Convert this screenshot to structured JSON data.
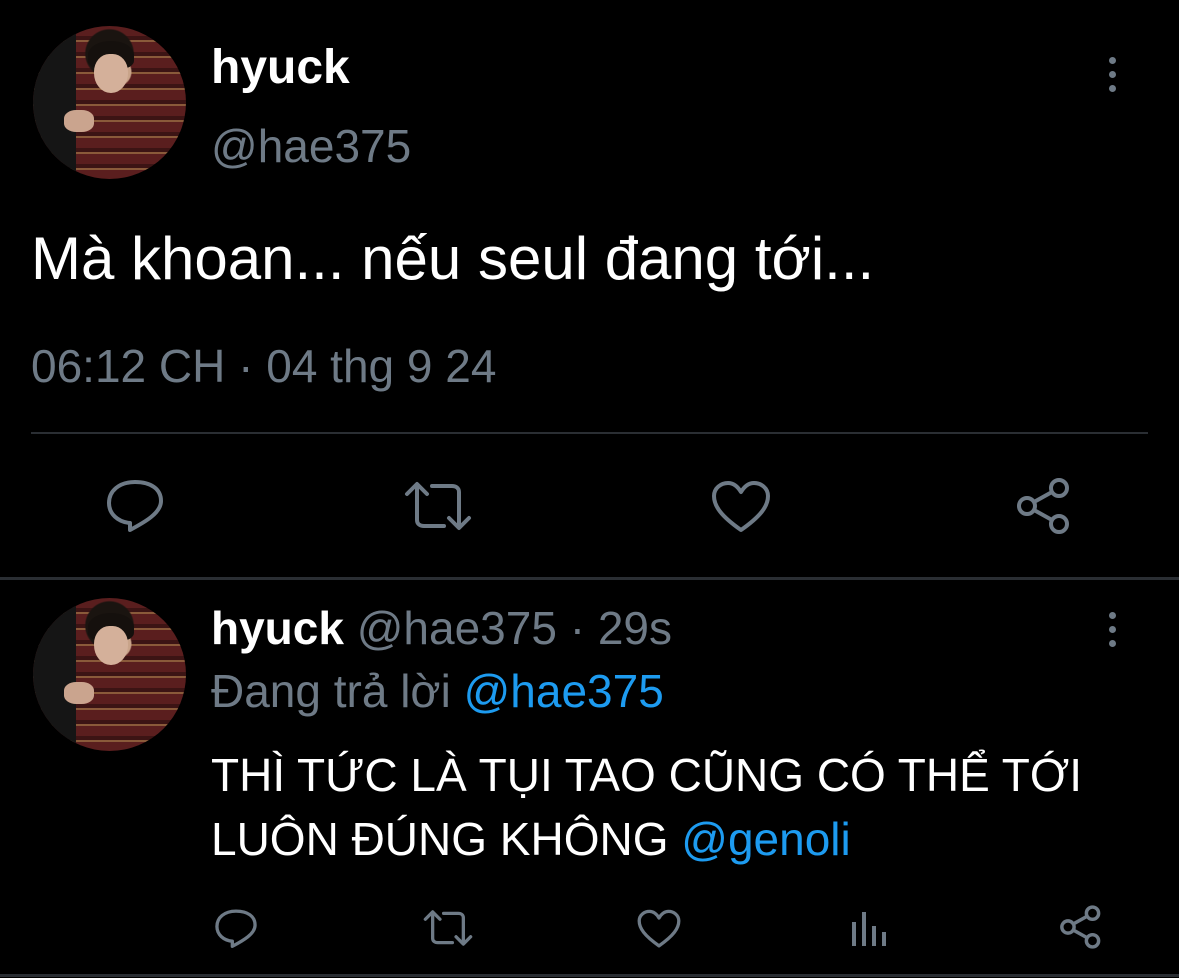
{
  "main_tweet": {
    "display_name": "hyuck",
    "handle": "@hae375",
    "text": "Mà khoan... nếu seul đang tới...",
    "time": "06:12 CH",
    "separator": "·",
    "date": "04 thg 9 24",
    "more_icon": "more-vertical-icon",
    "actions": [
      "reply-icon",
      "retweet-icon",
      "like-icon",
      "share-icon"
    ]
  },
  "reply_tweet": {
    "display_name": "hyuck",
    "handle": "@hae375",
    "separator": "·",
    "age": "29s",
    "replying_label": "Đang trả lời",
    "replying_to": "@hae375",
    "text_line1": "THÌ TỨC LÀ TỤI TAO CŨNG CÓ THỂ TỚI",
    "text_line2": "LUÔN ĐÚNG KHÔNG",
    "mention": "@genoli",
    "more_icon": "more-vertical-icon",
    "actions": [
      "reply-icon",
      "retweet-icon",
      "like-icon",
      "analytics-icon",
      "share-icon"
    ]
  },
  "colors": {
    "background": "#000000",
    "text": "#ffffff",
    "muted": "#6e7a86",
    "link": "#1d9bf0",
    "divider": "#2a2e33"
  }
}
